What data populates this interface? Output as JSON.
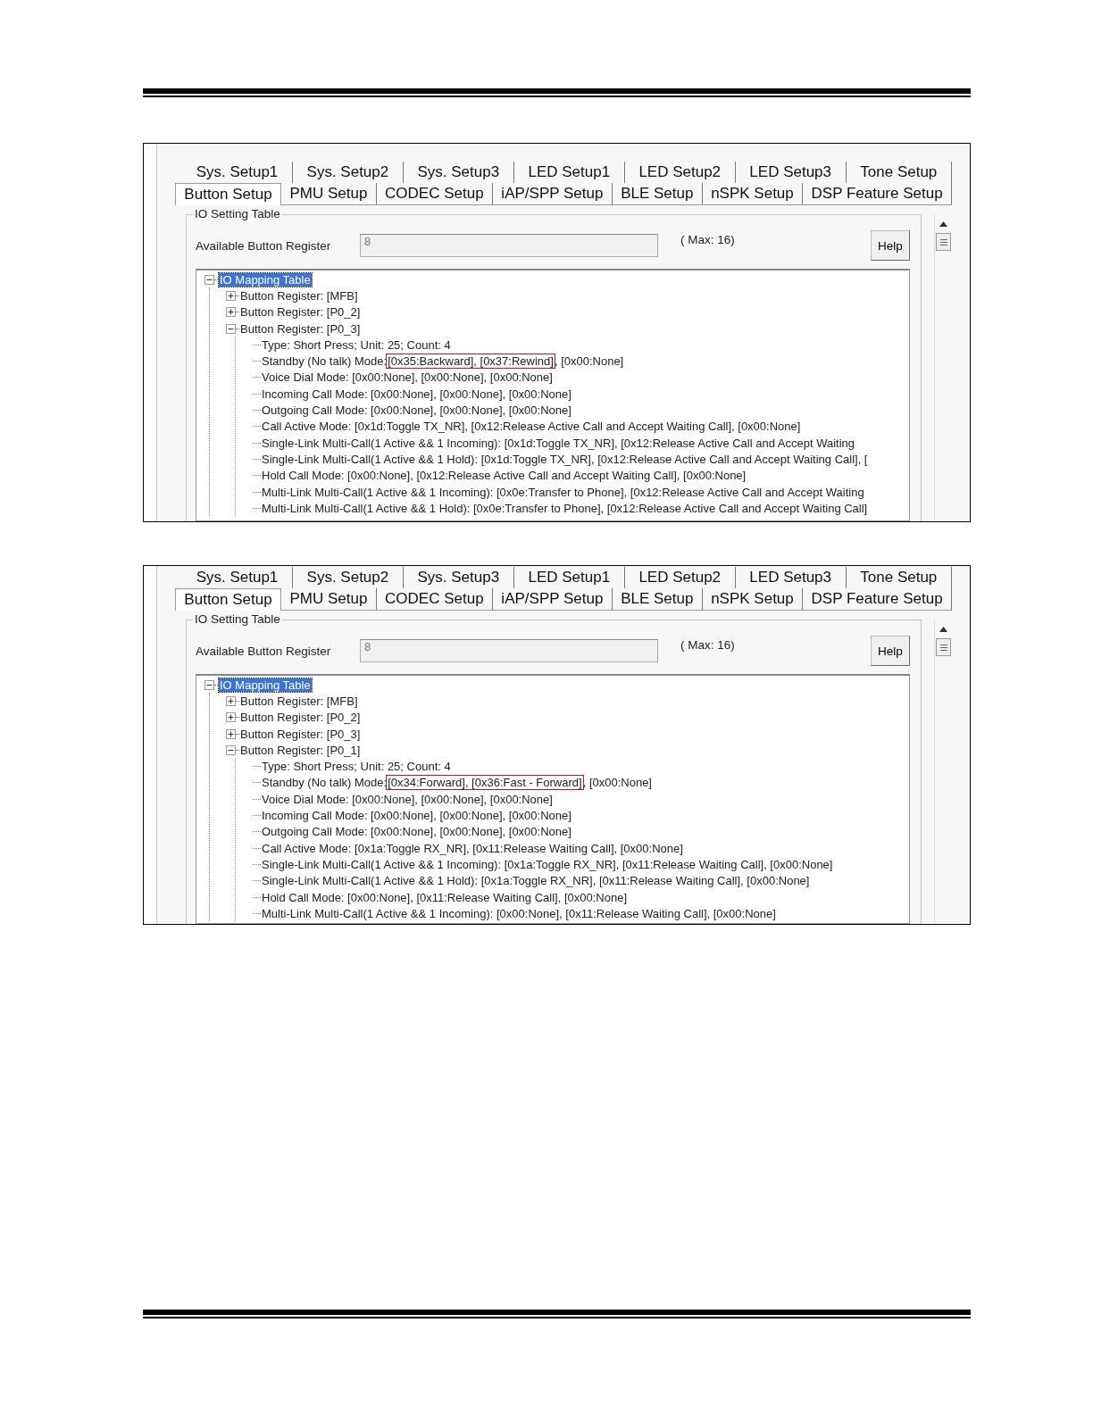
{
  "screenshots": [
    {
      "tab_rows": [
        [
          {
            "label": "Sys. Setup1",
            "selected": false
          },
          {
            "label": "Sys. Setup2",
            "selected": false
          },
          {
            "label": "Sys. Setup3",
            "selected": false
          },
          {
            "label": "LED Setup1",
            "selected": false
          },
          {
            "label": "LED Setup2",
            "selected": false
          },
          {
            "label": "LED Setup3",
            "selected": false
          },
          {
            "label": "Tone Setup",
            "selected": false
          }
        ],
        [
          {
            "label": "Button Setup",
            "selected": true
          },
          {
            "label": "PMU Setup",
            "selected": false
          },
          {
            "label": "CODEC Setup",
            "selected": false
          },
          {
            "label": "iAP/SPP Setup",
            "selected": false
          },
          {
            "label": "BLE Setup",
            "selected": false
          },
          {
            "label": "nSPK Setup",
            "selected": false
          },
          {
            "label": "DSP Feature Setup",
            "selected": false
          }
        ]
      ],
      "group_title": "IO Setting Table",
      "field_label": "Available Button Register",
      "field_value": "8",
      "max_text": "( Max: 16)",
      "help_button": "Help",
      "tree": {
        "label": "IO Mapping Table",
        "selected": true,
        "expanded": true,
        "children": [
          {
            "label": "Button Register: [MFB]",
            "expanded": false
          },
          {
            "label": "Button Register: [P0_2]",
            "expanded": false
          },
          {
            "label": "Button Register: [P0_3]",
            "expanded": true,
            "children": [
              {
                "label": "Type: Short Press; Unit: 25; Count: 4"
              },
              {
                "label": "Standby (No talk) Mode:",
                "boxed": "[0x35:Backward], [0x37:Rewind]",
                "rest": ", [0x00:None]"
              },
              {
                "label": "Voice Dial Mode: [0x00:None], [0x00:None], [0x00:None]"
              },
              {
                "label": "Incoming Call Mode: [0x00:None], [0x00:None], [0x00:None]"
              },
              {
                "label": "Outgoing Call Mode: [0x00:None], [0x00:None], [0x00:None]"
              },
              {
                "label": "Call Active Mode: [0x1d:Toggle TX_NR], [0x12:Release Active Call and Accept Waiting Call], [0x00:None]"
              },
              {
                "label": "Single-Link Multi-Call(1 Active && 1 Incoming): [0x1d:Toggle TX_NR], [0x12:Release Active Call and Accept Waiting"
              },
              {
                "label": "Single-Link Multi-Call(1 Active && 1 Hold): [0x1d:Toggle TX_NR], [0x12:Release Active Call and Accept Waiting Call], ["
              },
              {
                "label": "Hold Call Mode: [0x00:None], [0x12:Release Active Call and Accept Waiting Call], [0x00:None]"
              },
              {
                "label": "Multi-Link Multi-Call(1 Active && 1 Incoming): [0x0e:Transfer to Phone], [0x12:Release Active Call and Accept Waiting"
              },
              {
                "label": "Multi-Link Multi-Call(1 Active && 1 Hold): [0x0e:Transfer to Phone], [0x12:Release Active Call and Accept Waiting Call]"
              }
            ]
          }
        ]
      }
    },
    {
      "tab_rows": [
        [
          {
            "label": "Sys. Setup1",
            "selected": false
          },
          {
            "label": "Sys. Setup2",
            "selected": false
          },
          {
            "label": "Sys. Setup3",
            "selected": false
          },
          {
            "label": "LED Setup1",
            "selected": false
          },
          {
            "label": "LED Setup2",
            "selected": false
          },
          {
            "label": "LED Setup3",
            "selected": false
          },
          {
            "label": "Tone Setup",
            "selected": false
          }
        ],
        [
          {
            "label": "Button Setup",
            "selected": true
          },
          {
            "label": "PMU Setup",
            "selected": false
          },
          {
            "label": "CODEC Setup",
            "selected": false
          },
          {
            "label": "iAP/SPP Setup",
            "selected": false
          },
          {
            "label": "BLE Setup",
            "selected": false
          },
          {
            "label": "nSPK Setup",
            "selected": false
          },
          {
            "label": "DSP Feature Setup",
            "selected": false
          }
        ]
      ],
      "group_title": "IO Setting Table",
      "field_label": "Available Button Register",
      "field_value": "8",
      "max_text": "( Max: 16)",
      "help_button": "Help",
      "tree": {
        "label": "IO Mapping Table",
        "selected": true,
        "expanded": true,
        "children": [
          {
            "label": "Button Register: [MFB]",
            "expanded": false
          },
          {
            "label": "Button Register: [P0_2]",
            "expanded": false
          },
          {
            "label": "Button Register: [P0_3]",
            "expanded": false
          },
          {
            "label": "Button Register: [P0_1]",
            "expanded": true,
            "children": [
              {
                "label": "Type: Short Press; Unit: 25; Count: 4"
              },
              {
                "label": "Standby (No talk) Mode:",
                "boxed": "[0x34:Forward], [0x36:Fast - Forward]",
                "rest": ", [0x00:None]"
              },
              {
                "label": "Voice Dial Mode: [0x00:None], [0x00:None], [0x00:None]"
              },
              {
                "label": "Incoming Call Mode: [0x00:None], [0x00:None], [0x00:None]"
              },
              {
                "label": "Outgoing Call Mode: [0x00:None], [0x00:None], [0x00:None]"
              },
              {
                "label": "Call Active Mode: [0x1a:Toggle RX_NR], [0x11:Release Waiting Call], [0x00:None]"
              },
              {
                "label": "Single-Link Multi-Call(1 Active && 1 Incoming): [0x1a:Toggle RX_NR], [0x11:Release Waiting Call], [0x00:None]"
              },
              {
                "label": "Single-Link Multi-Call(1 Active && 1 Hold): [0x1a:Toggle RX_NR], [0x11:Release Waiting Call], [0x00:None]"
              },
              {
                "label": "Hold Call Mode: [0x00:None], [0x11:Release Waiting Call], [0x00:None]"
              },
              {
                "label": "Multi-Link Multi-Call(1 Active && 1 Incoming): [0x00:None], [0x11:Release Waiting Call], [0x00:None]"
              }
            ]
          }
        ]
      }
    }
  ]
}
